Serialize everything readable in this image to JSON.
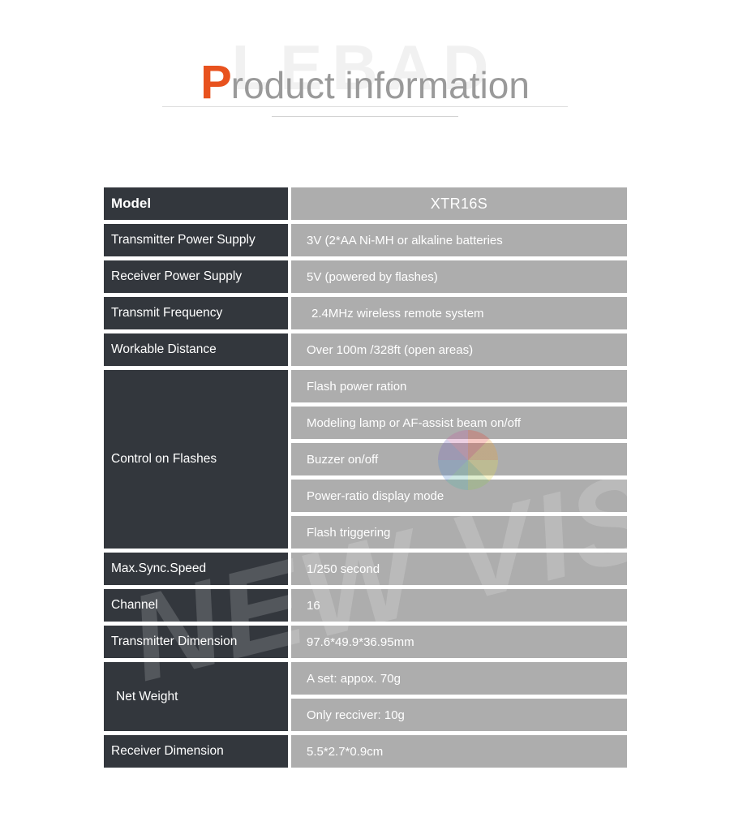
{
  "header": {
    "watermark_text": "LEBAD",
    "title_initial": "P",
    "title_rest": "roduct information"
  },
  "watermarks": {
    "diagonal_text": "NEW VISION",
    "wheel_icon": "color-wheel-icon"
  },
  "table": {
    "rows": [
      {
        "label": "Model",
        "is_header": true,
        "values": [
          "XTR16S"
        ],
        "align": "center"
      },
      {
        "label": "Transmitter Power Supply",
        "is_header": false,
        "values": [
          "3V (2*AA Ni-MH or alkaline batteries"
        ],
        "align": "left"
      },
      {
        "label": "Receiver Power Supply",
        "is_header": false,
        "values": [
          "5V (powered by flashes)"
        ],
        "align": "left"
      },
      {
        "label": "Transmit Frequency",
        "is_header": false,
        "values": [
          "2.4MHz wireless remote system"
        ],
        "align": "left-indented"
      },
      {
        "label": "Workable Distance",
        "is_header": false,
        "values": [
          "Over 100m /328ft (open areas)"
        ],
        "align": "left"
      },
      {
        "label": "Control on Flashes",
        "is_header": false,
        "values": [
          "Flash power ration",
          "Modeling lamp or AF-assist beam on/off",
          "Buzzer on/off",
          "Power-ratio display mode",
          "Flash triggering"
        ],
        "align": "left"
      },
      {
        "label": "Max.Sync.Speed",
        "is_header": false,
        "values": [
          "1/250 second"
        ],
        "align": "left"
      },
      {
        "label": "Channel",
        "is_header": false,
        "values": [
          "16"
        ],
        "align": "left"
      },
      {
        "label": "Transmitter Dimension",
        "is_header": false,
        "values": [
          "97.6*49.9*36.95mm"
        ],
        "align": "left"
      },
      {
        "label": "Net Weight",
        "is_header": false,
        "values": [
          "A set: appox. 70g",
          "Only recciver: 10g"
        ],
        "align": "left"
      },
      {
        "label": "Receiver Dimension",
        "is_header": false,
        "values": [
          "5.5*2.7*0.9cm"
        ],
        "align": "left"
      }
    ]
  },
  "colors": {
    "label_bg": "#33373d",
    "value_bg": "#adadad",
    "accent_orange": "#e8521e",
    "title_gray": "#9a9a9a",
    "page_bg": "#ffffff"
  }
}
